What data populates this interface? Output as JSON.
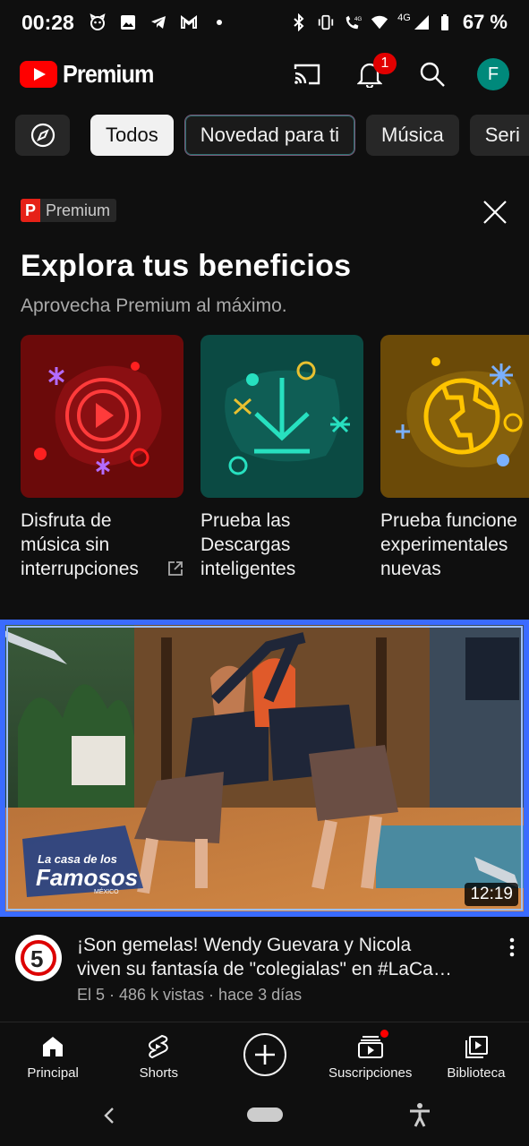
{
  "status_bar": {
    "time": "00:28",
    "battery": "67 %",
    "network": "4G"
  },
  "header": {
    "logo_text": "Premium",
    "notification_count": "1",
    "avatar_letter": "F"
  },
  "chips": [
    {
      "label": "Todos"
    },
    {
      "label": "Novedad para ti"
    },
    {
      "label": "Música"
    },
    {
      "label": "Seri"
    }
  ],
  "promo": {
    "badge_letter": "P",
    "badge_text": "Premium",
    "title": "Explora tus beneficios",
    "subtitle": "Aprovecha Premium al máximo.",
    "benefits": [
      {
        "label_lines": [
          "Disfruta de",
          "música sin",
          "interrupciones"
        ],
        "color": "#6b0a0a",
        "icon": "music-play-icon"
      },
      {
        "label_lines": [
          "Prueba las",
          "Descargas",
          "inteligentes"
        ],
        "color": "#0b4a43",
        "icon": "download-icon"
      },
      {
        "label_lines": [
          "Prueba funcione",
          "experimentales",
          "nuevas"
        ],
        "color": "#6b4a08",
        "icon": "globe-icon"
      }
    ]
  },
  "video": {
    "duration": "12:19",
    "title_line1": "¡Son gemelas! Wendy Guevara y Nicola",
    "title_line2": "viven su fantasía de \"colegialas\" en #LaCa…",
    "channel": "El 5",
    "views": "486 k vistas",
    "age": "hace 3 días",
    "subtitle": "El 5 · 486 k vistas · hace 3 días",
    "watermark_line1": "La casa de los",
    "watermark_line2": "Famosos",
    "watermark_line3": "MÉXICO"
  },
  "bottom_nav": [
    {
      "label": "Principal",
      "icon": "home-icon"
    },
    {
      "label": "Shorts",
      "icon": "shorts-icon"
    },
    {
      "label": "",
      "icon": "create-icon"
    },
    {
      "label": "Suscripciones",
      "icon": "subscriptions-icon"
    },
    {
      "label": "Biblioteca",
      "icon": "library-icon"
    }
  ]
}
